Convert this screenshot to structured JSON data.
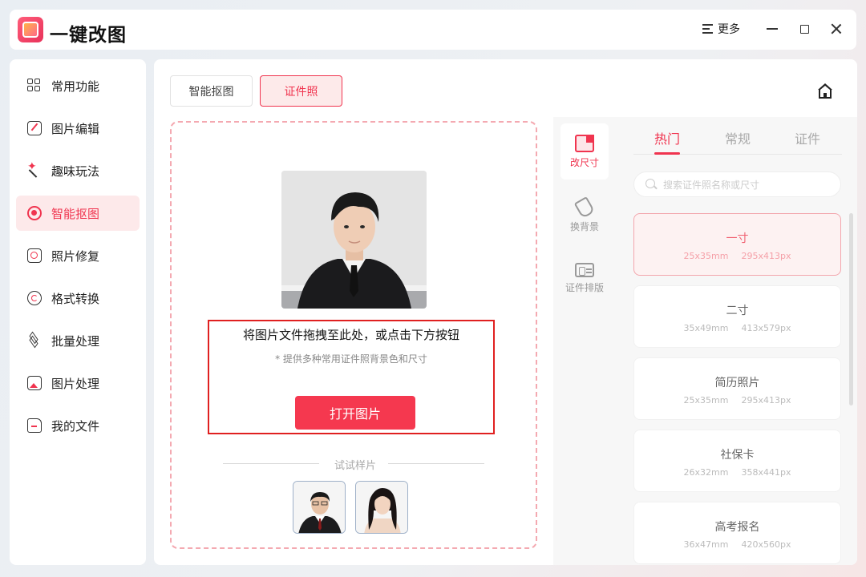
{
  "app": {
    "title": "一键改图",
    "more_label": "更多"
  },
  "sidebar": {
    "items": [
      {
        "label": "常用功能"
      },
      {
        "label": "图片编辑"
      },
      {
        "label": "趣味玩法"
      },
      {
        "label": "智能抠图"
      },
      {
        "label": "照片修复"
      },
      {
        "label": "格式转换"
      },
      {
        "label": "批量处理"
      },
      {
        "label": "图片处理"
      },
      {
        "label": "我的文件"
      }
    ]
  },
  "top_tabs": [
    {
      "label": "智能抠图"
    },
    {
      "label": "证件照"
    }
  ],
  "drop_zone": {
    "title": "将图片文件拖拽至此处，或点击下方按钮",
    "subtitle": "* 提供多种常用证件照背景色和尺寸",
    "button": "打开图片",
    "sample_label": "试试样片"
  },
  "tools": [
    {
      "label": "改尺寸"
    },
    {
      "label": "换背景"
    },
    {
      "label": "证件排版"
    }
  ],
  "size_tabs": [
    {
      "label": "热门"
    },
    {
      "label": "常规"
    },
    {
      "label": "证件"
    }
  ],
  "search": {
    "placeholder": "搜索证件照名称或尺寸"
  },
  "sizes": [
    {
      "name": "一寸",
      "mm": "25x35mm",
      "px": "295x413px"
    },
    {
      "name": "二寸",
      "mm": "35x49mm",
      "px": "413x579px"
    },
    {
      "name": "简历照片",
      "mm": "25x35mm",
      "px": "295x413px"
    },
    {
      "name": "社保卡",
      "mm": "26x32mm",
      "px": "358x441px"
    },
    {
      "name": "高考报名",
      "mm": "36x47mm",
      "px": "420x560px"
    }
  ],
  "colors": {
    "accent": "#f0344f",
    "highlight_box": "#e02020",
    "dashed_border": "#f4a9b1"
  }
}
